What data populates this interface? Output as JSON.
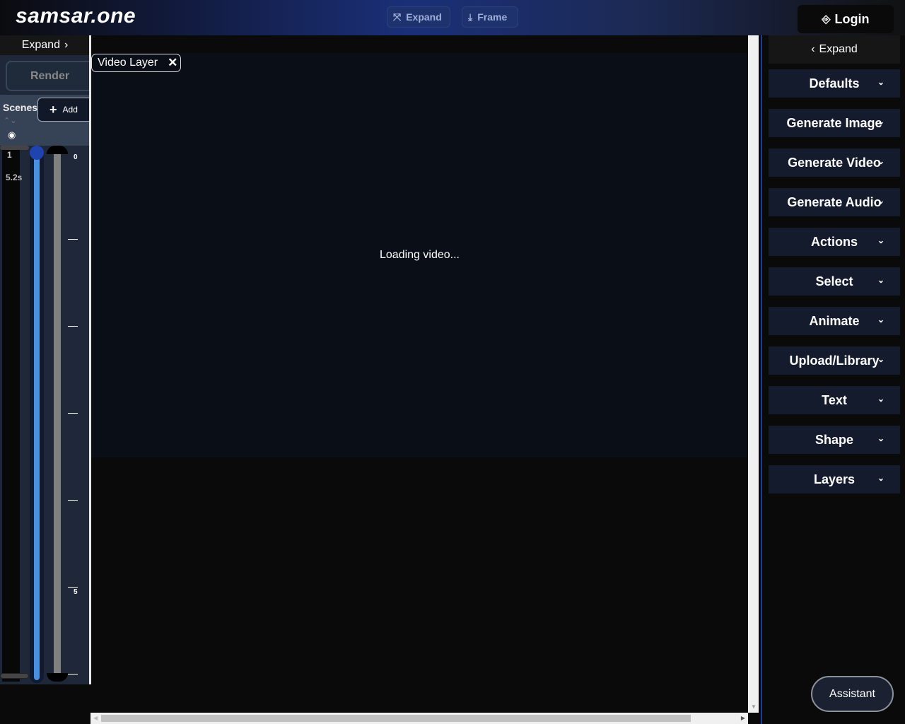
{
  "header": {
    "logo": "samsar.one",
    "expand_label": "Expand",
    "frame_label": "Frame",
    "login_label": "Login"
  },
  "left": {
    "expand_label": "Expand",
    "render_label": "Render",
    "scenes_label": "Scenes",
    "add_label": "Add",
    "scene_number": "1",
    "scene_duration": "5.2s",
    "ruler_labels": [
      "0",
      "5"
    ]
  },
  "canvas": {
    "layer_tag": "Video Layer",
    "loading_text": "Loading video..."
  },
  "right": {
    "expand_label": "Expand",
    "sections": [
      "Defaults",
      "Generate Image",
      "Generate Video",
      "Generate Audio",
      "Actions",
      "Select",
      "Animate",
      "Upload/Library",
      "Text",
      "Shape",
      "Layers"
    ]
  },
  "assistant_label": "Assistant",
  "colors": {
    "accent": "#1e3a9a",
    "track_blue": "#4a90e2",
    "thumb": "#1f44b0"
  }
}
